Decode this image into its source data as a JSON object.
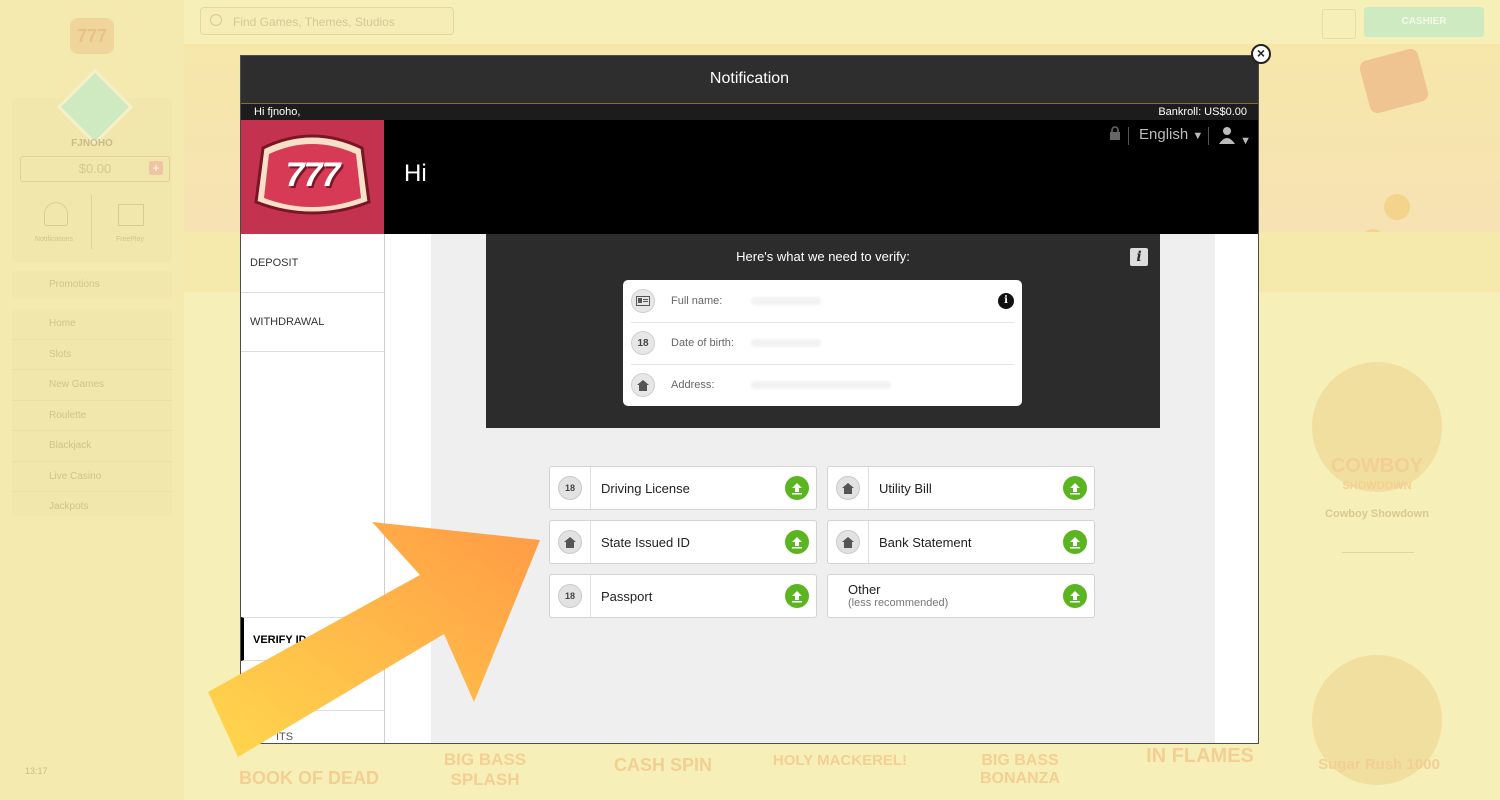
{
  "background": {
    "logo": "777",
    "username": "FJNOHO",
    "balance": "$0.00",
    "notifications_label": "Notifications",
    "freeplay_label": "FreePlay",
    "promotions": "Promotions",
    "nav": [
      "Home",
      "Slots",
      "New Games",
      "Roulette",
      "Blackjack",
      "Live Casino",
      "Jackpots"
    ],
    "time": "13:17",
    "search_placeholder": "Find Games, Themes, Studios",
    "cashier": "CASHIER",
    "featured_game_title": "COWBOY",
    "featured_game_subtitle": "SHOWDOWN",
    "featured_game_label": "Cowboy Showdown",
    "bottom_games": [
      "BOOK OF DEAD",
      "BIG BASS SPLASH",
      "CASH SPIN",
      "HOLY MACKEREL!",
      "BIG BASS BONANZA",
      "IN FLAMES",
      "Sugar Rush 1000"
    ]
  },
  "modal": {
    "title": "Notification",
    "greeting": "Hi fjnoho,",
    "bankroll": "Bankroll: US$0.00",
    "logo_text": "777",
    "hi": "Hi",
    "language": "English",
    "nav": {
      "deposit": "DEPOSIT",
      "withdrawal": "WITHDRAWAL",
      "verify": "VERIFY ID",
      "bottom": "ITS"
    },
    "verify": {
      "heading": "Here's what we need to verify:",
      "fields": [
        {
          "label": "Full name:",
          "icon": "id-card-icon"
        },
        {
          "label": "Date of birth:",
          "icon": "age-18-icon"
        },
        {
          "label": "Address:",
          "icon": "home-icon"
        }
      ]
    },
    "documents": [
      {
        "label": "Driving License",
        "icon": "18+"
      },
      {
        "label": "Utility Bill",
        "icon": "home"
      },
      {
        "label": "State Issued ID",
        "icon": "home"
      },
      {
        "label": "Bank Statement",
        "icon": "home"
      },
      {
        "label": "Passport",
        "icon": "18+"
      },
      {
        "label": "Other",
        "sub": "(less recommended)"
      }
    ],
    "colors": {
      "accent": "#c3324f",
      "upload": "#5bb521",
      "arrow_start": "#ffd84d",
      "arrow_end": "#ff9a45"
    }
  }
}
